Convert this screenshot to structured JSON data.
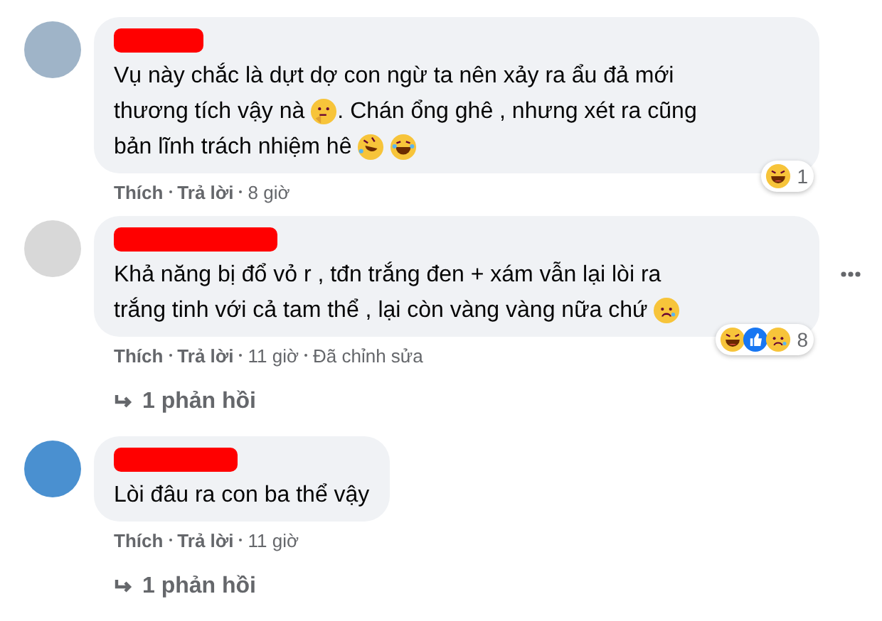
{
  "comments": [
    {
      "lines": [
        [
          {
            "kind": "text",
            "text": "Vụ này chắc là dựt dợ con ngừ ta nên xảy ra ẩu đả mới"
          }
        ],
        [
          {
            "kind": "text",
            "text": "thương tích vậy nà"
          },
          {
            "kind": "thinking"
          },
          {
            "kind": "text",
            "text": ". Chán ổng ghê , nhưng xét ra cũng"
          }
        ],
        [
          {
            "kind": "text",
            "text": "bản lĩnh trách nhiệm hê"
          },
          {
            "kind": "rofl"
          },
          {
            "kind": "joy"
          }
        ]
      ],
      "actions": [
        {
          "kind": "link",
          "label": "Thích"
        },
        {
          "kind": "link",
          "label": "Trả lời"
        },
        {
          "kind": "meta",
          "label": "8 giờ"
        }
      ],
      "reactions": [
        {
          "kind": "haha"
        }
      ],
      "reaction_count": "1",
      "more_menu": false
    },
    {
      "lines": [
        [
          {
            "kind": "text",
            "text": "Khả năng bị đổ vỏ r , tđn trắng đen + xám vẫn lại lòi ra"
          }
        ],
        [
          {
            "kind": "text",
            "text": "trắng tinh với cả tam thể , lại còn vàng vàng nữa chứ"
          },
          {
            "kind": "sad"
          }
        ]
      ],
      "actions": [
        {
          "kind": "link",
          "label": "Thích"
        },
        {
          "kind": "link",
          "label": "Trả lời"
        },
        {
          "kind": "meta",
          "label": "11 giờ"
        },
        {
          "kind": "meta",
          "label": "Đã chỉnh sửa"
        }
      ],
      "reactions": [
        {
          "kind": "haha"
        },
        {
          "kind": "like"
        },
        {
          "kind": "sad"
        }
      ],
      "reaction_count": "8",
      "more_menu": true,
      "replies": "1 phản hồi"
    },
    {
      "lines": [
        [
          {
            "kind": "text",
            "text": "Lòi đâu ra con ba thể vậy"
          }
        ]
      ],
      "actions": [
        {
          "kind": "link",
          "label": "Thích"
        },
        {
          "kind": "link",
          "label": "Trả lời"
        },
        {
          "kind": "meta",
          "label": "11 giờ"
        }
      ],
      "more_menu": false,
      "replies": "1 phản hồi"
    }
  ]
}
